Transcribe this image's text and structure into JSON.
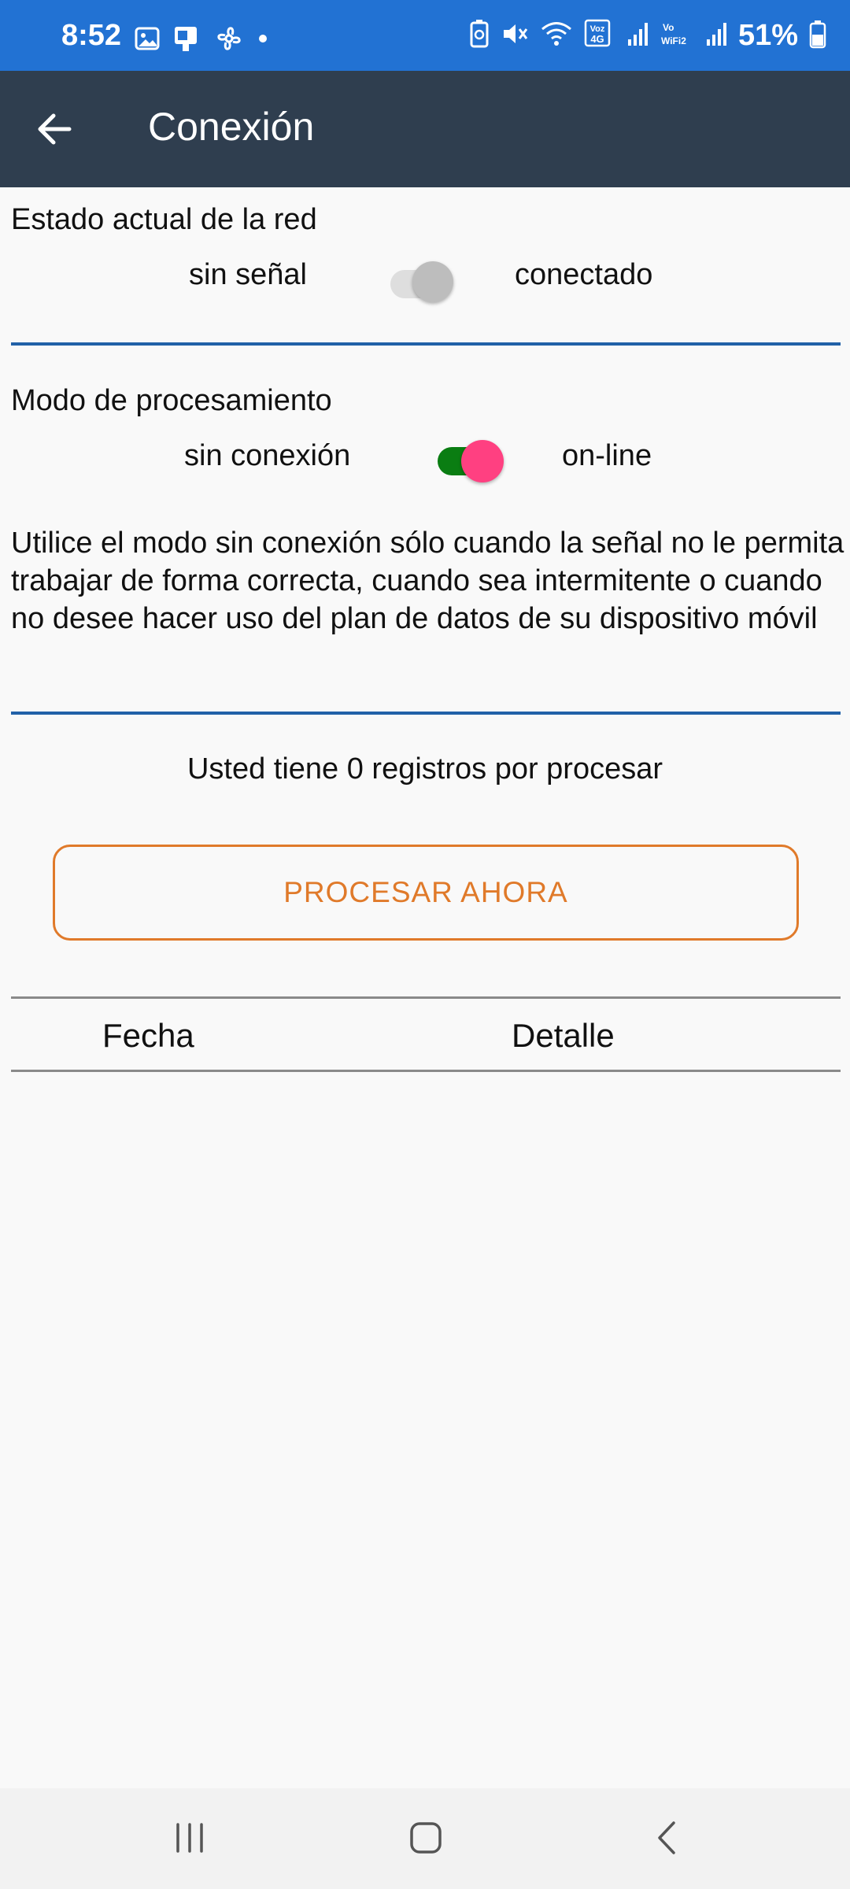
{
  "status_bar": {
    "time": "8:52",
    "battery_percent": "51%",
    "left_icons": [
      "image-icon",
      "card-icon",
      "fan-icon",
      "dot-icon"
    ],
    "right_icons": [
      "battery-saver-icon",
      "mute-icon",
      "wifi-icon",
      "volte-icon",
      "signal-icon",
      "vowifi-icon",
      "signal-icon",
      "battery-icon"
    ],
    "volte_label": "Voz 4G",
    "vowifi_label": "Vo WiFi2",
    "background_color": "#2272d3"
  },
  "app_bar": {
    "title": "Conexión",
    "back_icon": "arrow-left-icon",
    "background_color": "#2f3e4f"
  },
  "network_state": {
    "label": "Estado actual de la red",
    "off_label": "sin señal",
    "on_label": "conectado",
    "checked": false
  },
  "processing_mode": {
    "label": "Modo de procesamiento",
    "off_label": "sin conexión",
    "on_label": "on-line",
    "checked": true,
    "thumb_color": "#ff4081",
    "track_color": "#0a7d12"
  },
  "info": {
    "text": "Utilice el modo sin conexión sólo cuando la señal no le permita trabajar de forma correcta, cuando sea intermitente o cuando no desee hacer uso del plan de datos de su dispositivo móvil"
  },
  "pending": {
    "text": "Usted tiene 0 registros por procesar"
  },
  "process_button": {
    "label": "PROCESAR AHORA",
    "color": "#e07a2a"
  },
  "table": {
    "columns": [
      "Fecha",
      "Detalle"
    ],
    "rows": []
  },
  "nav_bar": {
    "icons": [
      "recents-icon",
      "home-icon",
      "back-icon"
    ]
  },
  "accent_divider_color": "#2161a8"
}
